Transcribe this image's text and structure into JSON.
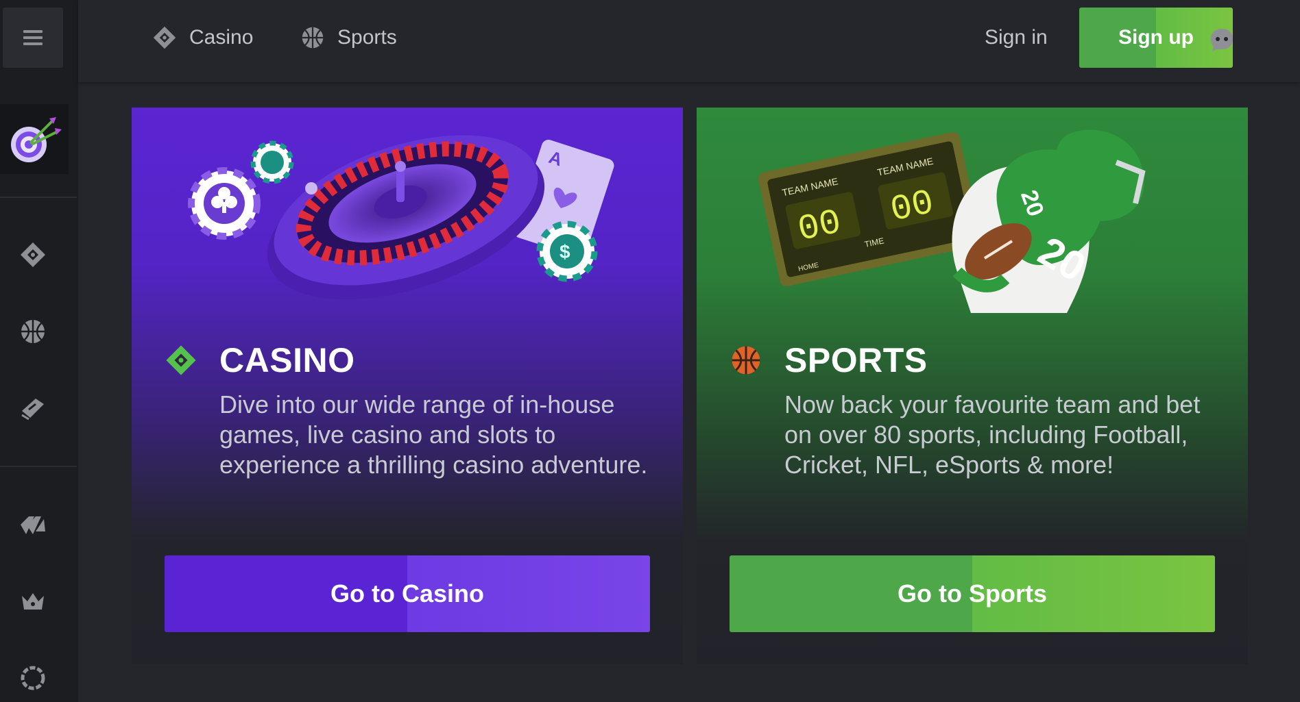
{
  "header": {
    "nav": [
      {
        "label": "Casino",
        "icon": "casino-icon"
      },
      {
        "label": "Sports",
        "icon": "sports-icon"
      }
    ],
    "signin_label": "Sign in",
    "signup_label": "Sign up",
    "chat_icon": "chat-icon"
  },
  "sidebar": {
    "menu_icon": "hamburger-icon",
    "promo_icon": "dartboard-icon",
    "items": [
      {
        "icon": "casino-icon"
      },
      {
        "icon": "sports-icon"
      },
      {
        "icon": "ticket-icon"
      },
      {
        "icon": "promotions-icon"
      },
      {
        "icon": "vip-crown-icon"
      },
      {
        "icon": "settings-icon"
      }
    ]
  },
  "cards": {
    "casino": {
      "title": "CASINO",
      "description": "Dive into our wide range of in-house games, live casino and slots to experience a thrilling casino adventure.",
      "button_label": "Go to Casino"
    },
    "sports": {
      "title": "SPORTS",
      "description": "Now back your favourite team and bet on over 80 sports, including Football, Cricket, NFL, eSports & more!",
      "button_label": "Go to Sports"
    }
  },
  "scoreboard": {
    "team_left": "TEAM NAME",
    "team_right": "TEAM NAME",
    "score_left": "00",
    "score_right": "00",
    "time_label": "TIME",
    "home_label": "HOME"
  },
  "player_number": "20",
  "colors": {
    "background": "#24262b",
    "sidebar": "#1b1d21",
    "casino_purple": "#5a24d4",
    "sports_green": "#4ea84a",
    "accent_green": "#7ac441"
  }
}
